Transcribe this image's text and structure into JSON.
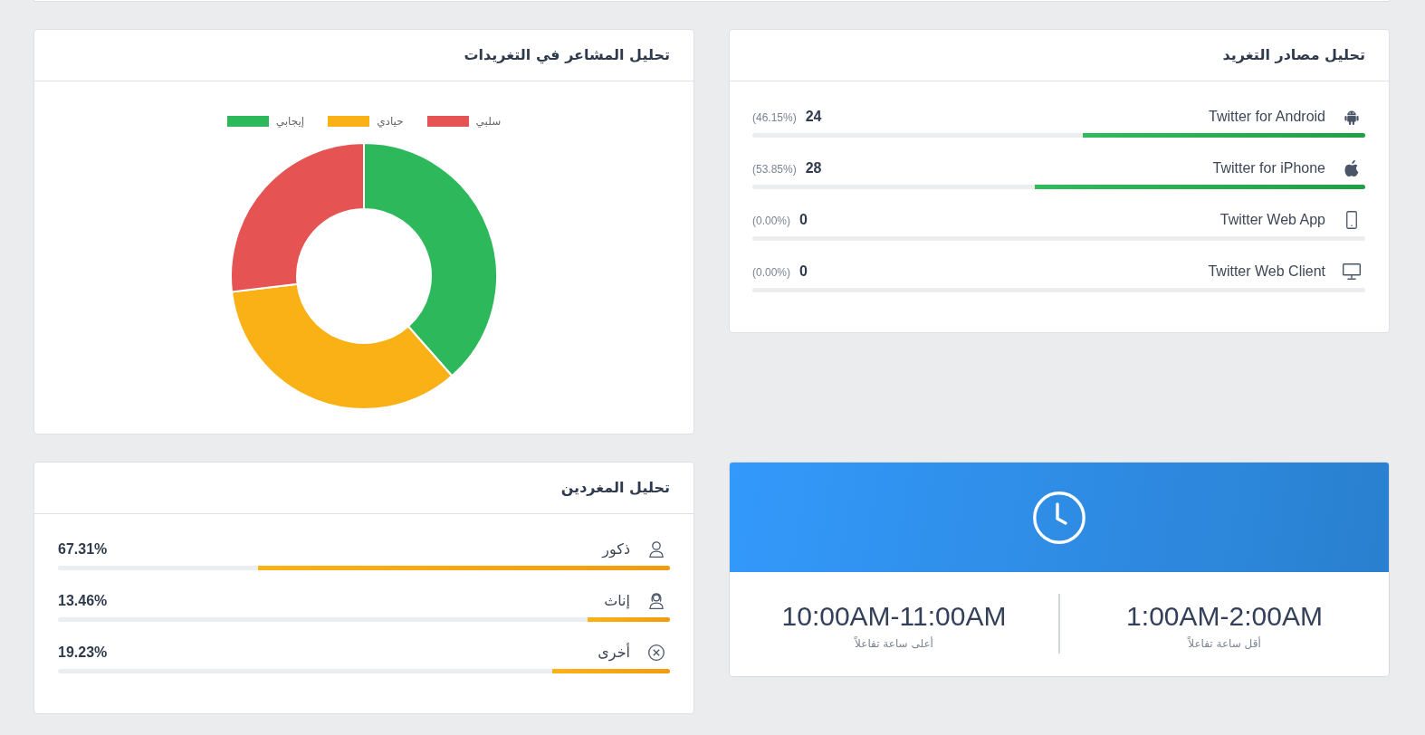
{
  "sources": {
    "title": "تحليل مصادر التغريد",
    "items": [
      {
        "kind": "android",
        "name": "Twitter for Android",
        "count": "24",
        "percent": "(46.15%)",
        "level": 0.4615
      },
      {
        "kind": "apple",
        "name": "Twitter for iPhone",
        "count": "28",
        "percent": "(53.85%)",
        "level": 0.5385
      },
      {
        "kind": "phone",
        "name": "Twitter Web App",
        "count": "0",
        "percent": "(0.00%)",
        "level": 0
      },
      {
        "kind": "monitor",
        "name": "Twitter Web Client",
        "count": "0",
        "percent": "(0.00%)",
        "level": 0
      }
    ]
  },
  "sentiment": {
    "title": "تحليل المشاعر في التغريدات",
    "chart_data": {
      "type": "donut",
      "legend": "top",
      "categories": [
        "إيجابي",
        "حيادي",
        "سلبي"
      ],
      "values": [
        38.5,
        34.6,
        26.9
      ],
      "colors": [
        "#2eb85c",
        "#f9b115",
        "#e55353"
      ]
    }
  },
  "peak_hours": {
    "items": [
      {
        "time": "1:00AM-2:00AM",
        "label": "أقل ساعة تفاعلاً"
      },
      {
        "time": "10:00AM-11:00AM",
        "label": "أعلى ساعة تفاعلاً"
      }
    ]
  },
  "users": {
    "title": "تحليل المغردين",
    "items": [
      {
        "kind": "male",
        "label": "ذكور",
        "percent": "67.31%",
        "level": 0.6731
      },
      {
        "kind": "female",
        "label": "إناث",
        "percent": "13.46%",
        "level": 0.1346
      },
      {
        "kind": "other",
        "label": "أخرى",
        "percent": "19.23%",
        "level": 0.1923
      }
    ]
  }
}
